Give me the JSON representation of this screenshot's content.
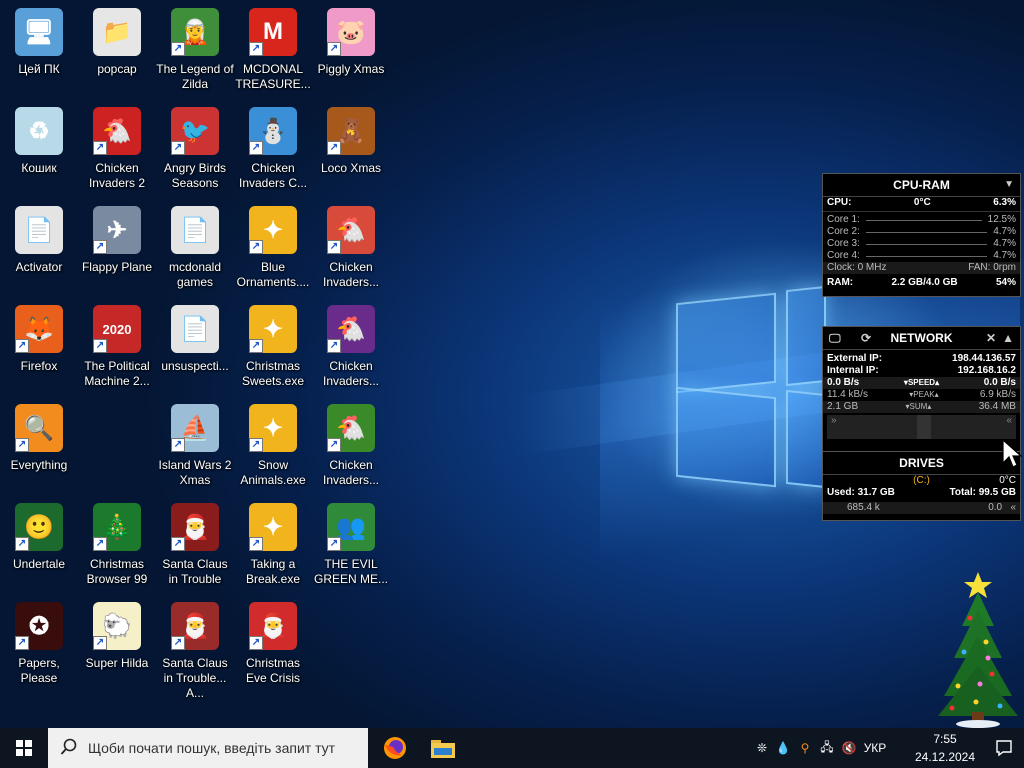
{
  "desktop": {
    "icons": [
      {
        "label": "Цей ПК",
        "glyph": "🖥",
        "color": "#5aa0d8",
        "shortcut": false
      },
      {
        "label": "popcap",
        "glyph": "📁",
        "color": "#e6e6e6",
        "shortcut": false
      },
      {
        "label": "The Legend of Zilda",
        "glyph": "🧝",
        "color": "#3f8f3a",
        "shortcut": true
      },
      {
        "label": "MCDONAL TREASURE...",
        "glyph": "M",
        "color": "#d8261d",
        "shortcut": true
      },
      {
        "label": "Piggly Xmas",
        "glyph": "🐷",
        "color": "#ef9ac8",
        "shortcut": true
      },
      {
        "label": "Кошик",
        "glyph": "♻",
        "color": "#b7d9e8",
        "shortcut": false
      },
      {
        "label": "Chicken Invaders 2",
        "glyph": "🐔",
        "color": "#cc2222",
        "shortcut": true
      },
      {
        "label": "Angry Birds Seasons",
        "glyph": "🐦",
        "color": "#c33",
        "shortcut": true
      },
      {
        "label": "Chicken Invaders C...",
        "glyph": "⛄",
        "color": "#3a8fd6",
        "shortcut": true
      },
      {
        "label": "Loco Xmas",
        "glyph": "🧸",
        "color": "#a7591c",
        "shortcut": true
      },
      {
        "label": "Activator",
        "glyph": "📄",
        "color": "#e4e4e4",
        "shortcut": false
      },
      {
        "label": "Flappy Plane",
        "glyph": "✈",
        "color": "#7a8aa0",
        "shortcut": true
      },
      {
        "label": "mcdonald games",
        "glyph": "📄",
        "color": "#e4e4e4",
        "shortcut": false
      },
      {
        "label": "Blue Ornaments....",
        "glyph": "✦",
        "color": "#f1b41c",
        "shortcut": true
      },
      {
        "label": "Chicken Invaders...",
        "glyph": "🐔",
        "color": "#d84a3a",
        "shortcut": true
      },
      {
        "label": "Firefox",
        "glyph": "🦊",
        "color": "#e8601c",
        "shortcut": true
      },
      {
        "label": "The Political Machine 2...",
        "glyph": "2020",
        "color": "#c62828",
        "shortcut": true
      },
      {
        "label": "unsuspecti...",
        "glyph": "📄",
        "color": "#e4e4e4",
        "shortcut": false
      },
      {
        "label": "Christmas Sweets.exe",
        "glyph": "✦",
        "color": "#f1b41c",
        "shortcut": true
      },
      {
        "label": "Chicken Invaders...",
        "glyph": "🐔",
        "color": "#6a2c8a",
        "shortcut": true
      },
      {
        "label": "Everything",
        "glyph": "🔍",
        "color": "#f28c1e",
        "shortcut": true
      },
      {
        "label": "",
        "glyph": "",
        "color": "",
        "shortcut": false
      },
      {
        "label": "Island Wars 2 Xmas",
        "glyph": "⛵",
        "color": "#9bbdd6",
        "shortcut": true
      },
      {
        "label": "Snow Animals.exe",
        "glyph": "✦",
        "color": "#f1b41c",
        "shortcut": true
      },
      {
        "label": "Chicken Invaders...",
        "glyph": "🐔",
        "color": "#3b8a2a",
        "shortcut": true
      },
      {
        "label": "Undertale",
        "glyph": "🙂",
        "color": "#1c6a2e",
        "shortcut": true
      },
      {
        "label": "Christmas Browser 99",
        "glyph": "🎄",
        "color": "#1b7a2b",
        "shortcut": true
      },
      {
        "label": "Santa Claus in Trouble",
        "glyph": "🎅",
        "color": "#8a1c1c",
        "shortcut": true
      },
      {
        "label": "Taking a Break.exe",
        "glyph": "✦",
        "color": "#f1b41c",
        "shortcut": true
      },
      {
        "label": "THE EVIL GREEN ME...",
        "glyph": "👥",
        "color": "#2f8a3a",
        "shortcut": true
      },
      {
        "label": "Papers, Please",
        "glyph": "✪",
        "color": "#3a0d0d",
        "shortcut": true
      },
      {
        "label": "Super Hilda",
        "glyph": "🐑",
        "color": "#f5f0c8",
        "shortcut": true
      },
      {
        "label": "Santa Claus in Trouble... A...",
        "glyph": "🎅",
        "color": "#9a2b2b",
        "shortcut": true
      },
      {
        "label": "Christmas Eve Crisis",
        "glyph": "🎅",
        "color": "#d12b2b",
        "shortcut": true
      }
    ]
  },
  "cpu_ram": {
    "title": "CPU-RAM",
    "cpu_label": "CPU:",
    "cpu_temp": "0°C",
    "cpu_value": "6.3%",
    "cores": [
      {
        "label": "Core 1:",
        "value": "12.5%"
      },
      {
        "label": "Core 2:",
        "value": "4.7%"
      },
      {
        "label": "Core 3:",
        "value": "4.7%"
      },
      {
        "label": "Core 4:",
        "value": "4.7%"
      }
    ],
    "clock_label": "Clock:",
    "clock_value": "0 MHz",
    "fan_label": "FAN:",
    "fan_value": "0rpm",
    "ram_label": "RAM:",
    "ram_value": "2.2 GB/4.0 GB",
    "ram_pct": "54%"
  },
  "network": {
    "title": "NETWORK",
    "ext_label": "External IP:",
    "ext_value": "198.44.136.57",
    "int_label": "Internal IP:",
    "int_value": "192.168.16.2",
    "speed_left": "0.0 B/s",
    "speed_label": "SPEED",
    "speed_right": "0.0 B/s",
    "peak_left": "11.4 kB/s",
    "peak_label": "PEAK",
    "peak_right": "6.9 kB/s",
    "sum_left": "2.1 GB",
    "sum_label": "SUM",
    "sum_right": "36.4 MB"
  },
  "drives": {
    "title": "DRIVES",
    "drive": "(C:)",
    "temp": "0°C",
    "used_label": "Used:",
    "used_value": "31.7 GB",
    "total_label": "Total:",
    "total_value": "99.5 GB",
    "read": "685.4 k",
    "write": "0.0"
  },
  "taskbar": {
    "search_placeholder": "Щоби почати пошук, введіть запит тут",
    "lang": "УКР",
    "time": "7:55",
    "date": "24.12.2024"
  },
  "colors": {
    "taskbar": "#0d1521",
    "accent": "#f1b41c"
  }
}
